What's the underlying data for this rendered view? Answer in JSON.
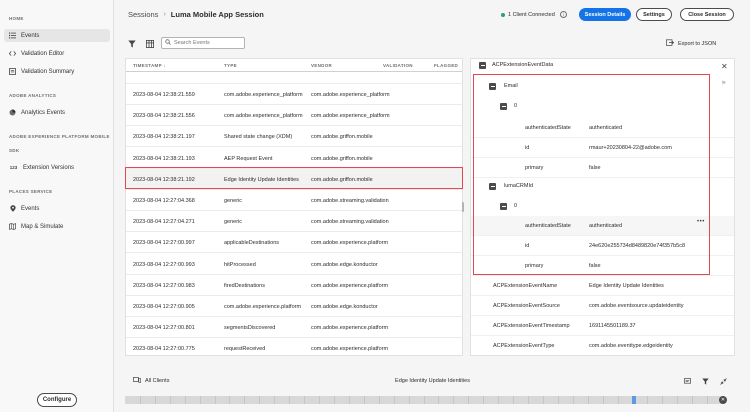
{
  "sidebar": {
    "sections": {
      "home": "HOME",
      "adobe_analytics": "ADOBE ANALYTICS",
      "aep_mobile": "ADOBE EXPERIENCE PLATFORM MOBILE",
      "sdk": "SDK",
      "places": "PLACES SERVICE"
    },
    "items": {
      "events": "Events",
      "validation_editor": "Validation Editor",
      "validation_summary": "Validation Summary",
      "analytics_events": "Analytics Events",
      "extension_versions": "Extension Versions",
      "places_events": "Events",
      "map_simulate": "Map & Simulate"
    },
    "configure_label": "Configure"
  },
  "header": {
    "breadcrumb_root": "Sessions",
    "breadcrumb_current": "Luma Mobile App Session",
    "client_status": "1 Client Connected",
    "session_details_label": "Session Details",
    "settings_label": "Settings",
    "close_session_label": "Close Session"
  },
  "toolbar": {
    "search_placeholder": "Search Events",
    "export_label": "Export to JSON"
  },
  "table": {
    "headers": {
      "timestamp": "TIMESTAMP",
      "type": "TYPE",
      "vendor": "VENDOR",
      "validation": "VALIDATION",
      "flagged": "FLAGGED"
    },
    "rows": [
      {
        "timestamp": "2023-08-04 12:38:21.559",
        "type": "com.adobe.experience_platform",
        "vendor": "com.adobe.experience_platform"
      },
      {
        "timestamp": "2023-08-04 12:38:21.556",
        "type": "com.adobe.experience_platform",
        "vendor": "com.adobe.experience_platform"
      },
      {
        "timestamp": "2023-08-04 12:38:21.197",
        "type": "Shared state change (XDM)",
        "vendor": "com.adobe.griffon.mobile"
      },
      {
        "timestamp": "2023-08-04 12:38:21.193",
        "type": "AEP Request Event",
        "vendor": "com.adobe.griffon.mobile"
      },
      {
        "timestamp": "2023-08-04 12:38:21.192",
        "type": "Edge Identity Update Identities",
        "vendor": "com.adobe.griffon.mobile"
      },
      {
        "timestamp": "2023-08-04 12:27:04.368",
        "type": "generic",
        "vendor": "com.adobe.streaming.validation"
      },
      {
        "timestamp": "2023-08-04 12:27:04.271",
        "type": "generic",
        "vendor": "com.adobe.streaming.validation"
      },
      {
        "timestamp": "2023-08-04 12:27:00.997",
        "type": "applicableDestinations",
        "vendor": "com.adobe.experience.platform"
      },
      {
        "timestamp": "2023-08-04 12:27:00.993",
        "type": "hitProcessed",
        "vendor": "com.adobe.edge.konductor"
      },
      {
        "timestamp": "2023-08-04 12:27:00.983",
        "type": "firedDestinations",
        "vendor": "com.adobe.experience.platform"
      },
      {
        "timestamp": "2023-08-04 12:27:00.905",
        "type": "com.adobe.experience.platform",
        "vendor": "com.adobe.edge.konductor"
      },
      {
        "timestamp": "2023-08-04 12:27:00.801",
        "type": "segmentsDiscovered",
        "vendor": "com.adobe.experience.platform"
      },
      {
        "timestamp": "2023-08-04 12:27:00.775",
        "type": "requestReceived",
        "vendor": "com.adobe.experience.platform"
      }
    ]
  },
  "details": {
    "root_key": "ACPExtensionEventData",
    "email_key": "Email",
    "luma_key": "lumaCRMId",
    "index_0": "0",
    "email_fields": [
      {
        "key": "authenticatedState",
        "value": "authenticated"
      },
      {
        "key": "id",
        "value": "rmaur+20230804-22@adobe.com"
      },
      {
        "key": "primary",
        "value": "false"
      }
    ],
    "luma_fields": [
      {
        "key": "authenticatedState",
        "value": "authenticated"
      },
      {
        "key": "id",
        "value": "24e620e255734d8489820e74f357b5c8"
      },
      {
        "key": "primary",
        "value": "false"
      }
    ],
    "meta_fields": [
      {
        "key": "ACPExtensionEventName",
        "value": "Edge Identity Update Identities"
      },
      {
        "key": "ACPExtensionEventSource",
        "value": "com.adobe.eventsource.updateidentity"
      },
      {
        "key": "ACPExtensionEventTimestamp",
        "value": "1691145501189.37"
      },
      {
        "key": "ACPExtensionEventType",
        "value": "com.adobe.eventtype.edgeidentity"
      }
    ]
  },
  "timeline": {
    "clients_label": "All Clients",
    "title": "Edge Identity Update Identities",
    "marker_fraction": 0.85
  },
  "colors": {
    "accent": "#1473e6",
    "highlight": "#e34850",
    "status_ok": "#2d9d78"
  }
}
